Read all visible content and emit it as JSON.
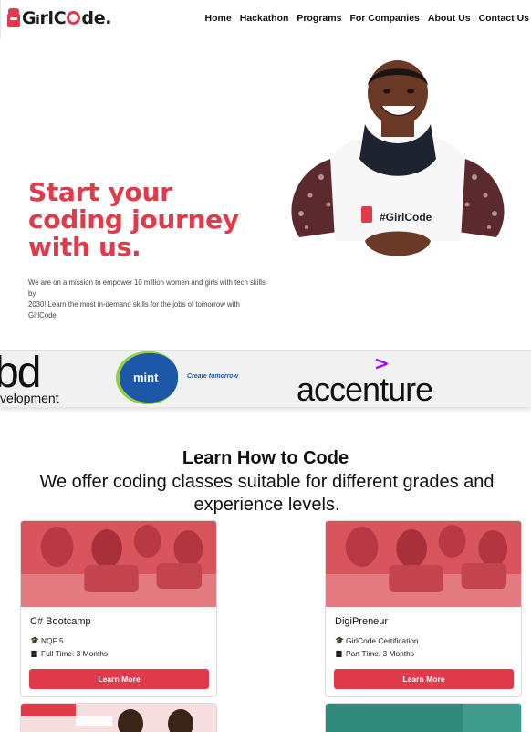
{
  "brand": {
    "logo_text_pre": "G",
    "logo_text_mid": "rlC",
    "logo_text_post": "de.",
    "logo_alt": "GirlCode.",
    "accent": "#e03a4b"
  },
  "nav": {
    "items": [
      "Home",
      "Hackathon",
      "Programs",
      "For Companies",
      "About Us",
      "Contact Us"
    ]
  },
  "hero": {
    "title": "Start your coding journey with us.",
    "description_line1": "We are on a mission to empower 10 million women and girls with tech skills by",
    "description_line2": "2030! Learn the most in-demand skills for the jobs of tomorrow with GirlCode.",
    "photo_shirt_text": "#GirlCode"
  },
  "partners": {
    "dbd_logo": "bd",
    "dbd_sub": "velopment",
    "mint_logo": "mint",
    "mint_tagline": "Create tomorrow",
    "accenture_logo": "accenture",
    "accenture_mark": ">"
  },
  "section": {
    "title": "Learn How to Code",
    "subtitle": "We offer coding classes suitable for different grades and experience levels."
  },
  "courses": [
    {
      "name": "C# Bootcamp",
      "qualification": "NQF 5",
      "duration": "Full Time: 3 Months",
      "button": "Learn More",
      "qualification_icon": "graduation-cap-icon",
      "duration_icon": "calendar-icon"
    },
    {
      "name": "DigiPreneur",
      "qualification": "GirlCode Certification",
      "duration": "Part Time: 3 Months",
      "button": "Learn More",
      "qualification_icon": "graduation-cap-icon",
      "duration_icon": "calendar-icon"
    }
  ],
  "colors": {
    "accent": "#e03a4b",
    "card_image_tint": "#d9555e",
    "accenture_purple": "#a100ff",
    "mint_blue": "#1d57a8",
    "mint_green": "#8fcf4a",
    "teal_card": "#2f8a7b"
  }
}
